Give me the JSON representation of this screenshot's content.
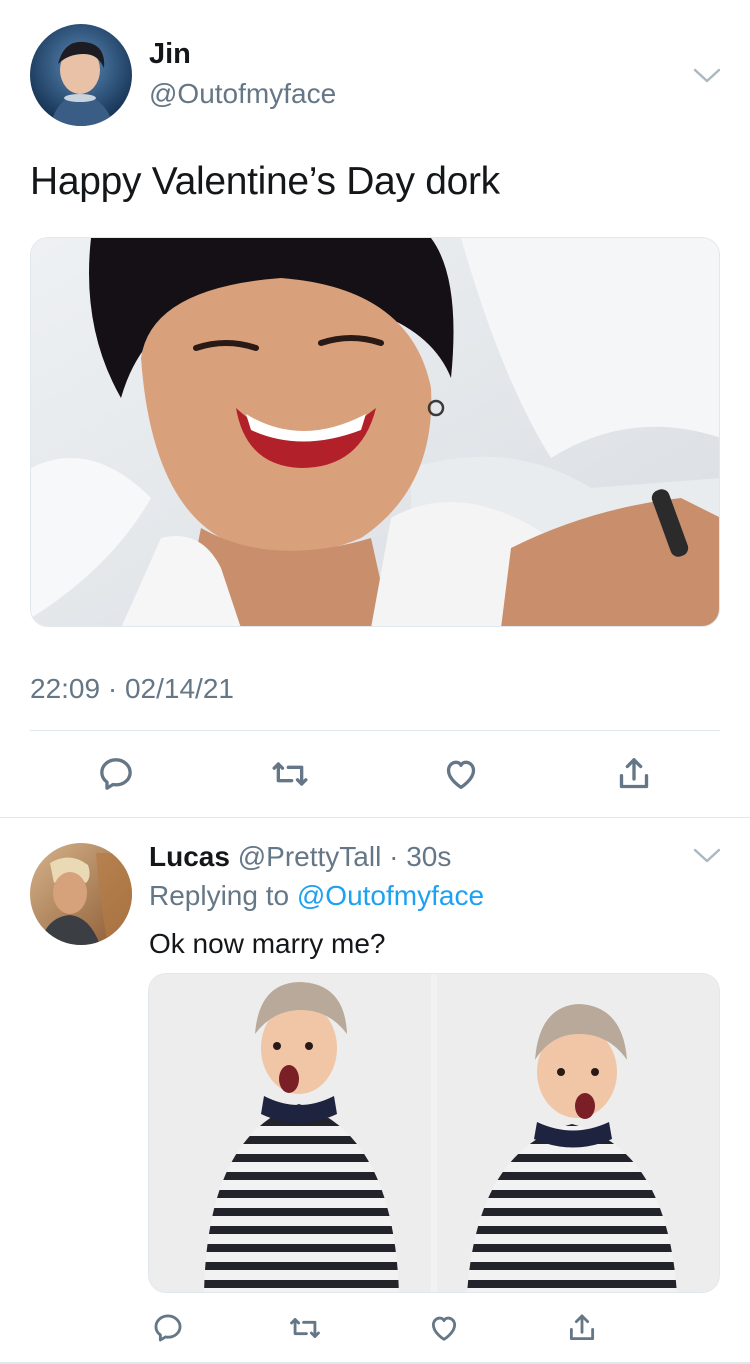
{
  "main_tweet": {
    "author_name": "Jin",
    "author_handle": "@Outofmyface",
    "text": "Happy Valentine’s Day dork",
    "time": "22:09",
    "separator": " · ",
    "date": "02/14/21"
  },
  "reply": {
    "author_name": "Lucas",
    "author_handle": "@PrettyTall",
    "separator": " · ",
    "time": "30s",
    "replying_prefix": "Replying to ",
    "replying_to": "@Outofmyface",
    "text": "Ok now marry me?"
  },
  "colors": {
    "text_primary": "#14171a",
    "text_secondary": "#657786",
    "link": "#1da1f2",
    "divider": "#e1e8ed"
  },
  "icons": {
    "actions": [
      "reply-icon",
      "retweet-icon",
      "like-icon",
      "share-icon"
    ],
    "menu": "chevron-down-icon"
  }
}
